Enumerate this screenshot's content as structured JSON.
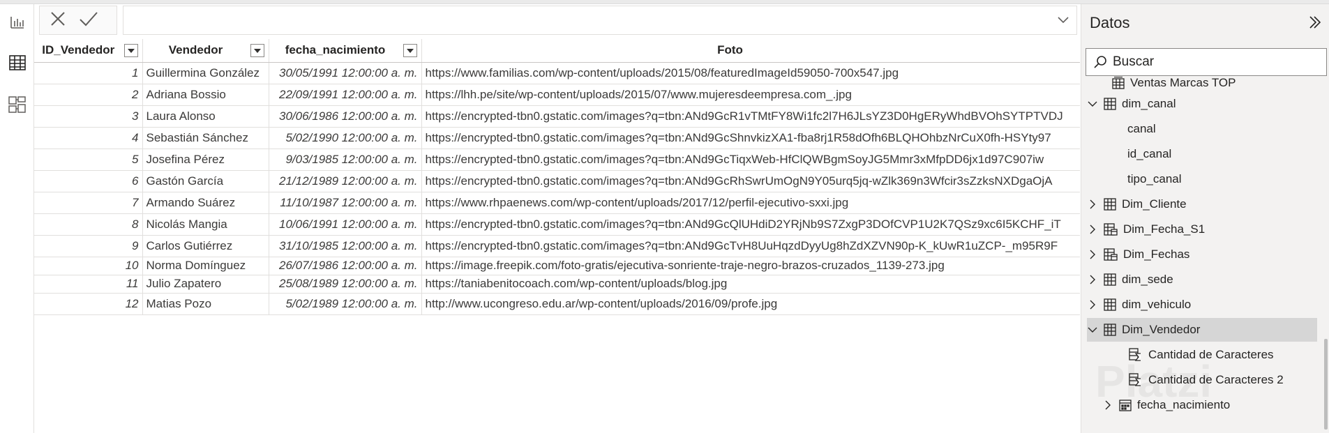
{
  "formula_bar": {
    "cancel_icon": "close-icon",
    "commit_icon": "checkmark-icon",
    "value": ""
  },
  "table": {
    "columns": [
      "ID_Vendedor",
      "Vendedor",
      "fecha_nacimiento",
      "Foto"
    ],
    "rows": [
      {
        "id": "1",
        "vendedor": "Guillermina González",
        "fecha": "30/05/1991 12:00:00 a. m.",
        "foto": "https://www.familias.com/wp-content/uploads/2015/08/featuredImageId59050-700x547.jpg"
      },
      {
        "id": "2",
        "vendedor": "Adriana Bossio",
        "fecha": "22/09/1991 12:00:00 a. m.",
        "foto": "https://lhh.pe/site/wp-content/uploads/2015/07/www.mujeresdeempresa.com_.jpg"
      },
      {
        "id": "3",
        "vendedor": "Laura Alonso",
        "fecha": "30/06/1986 12:00:00 a. m.",
        "foto": "https://encrypted-tbn0.gstatic.com/images?q=tbn:ANd9GcR1vTMtFY8Wi1fc2l7H6JLsYZ3D0HgERyWhdBVOhSYTPTVDJ"
      },
      {
        "id": "4",
        "vendedor": "Sebastián Sánchez",
        "fecha": "5/02/1990 12:00:00 a. m.",
        "foto": "https://encrypted-tbn0.gstatic.com/images?q=tbn:ANd9GcShnvkizXA1-fba8rj1R58dOfh6BLQHOhbzNrCuX0fh-HSYty97"
      },
      {
        "id": "5",
        "vendedor": "Josefina Pérez",
        "fecha": "9/03/1985 12:00:00 a. m.",
        "foto": "https://encrypted-tbn0.gstatic.com/images?q=tbn:ANd9GcTiqxWeb-HfClQWBgmSoyJG5Mmr3xMfpDD6jx1d97C907iw"
      },
      {
        "id": "6",
        "vendedor": "Gastón García",
        "fecha": "21/12/1989 12:00:00 a. m.",
        "foto": "https://encrypted-tbn0.gstatic.com/images?q=tbn:ANd9GcRhSwrUmOgN9Y05urq5jq-wZlk369n3Wfcir3sZzksNXDgaOjA"
      },
      {
        "id": "7",
        "vendedor": "Armando Suárez",
        "fecha": "11/10/1987 12:00:00 a. m.",
        "foto": "https://www.rhpaenews.com/wp-content/uploads/2017/12/perfil-ejecutivo-sxxi.jpg"
      },
      {
        "id": "8",
        "vendedor": "Nicolás Mangia",
        "fecha": "10/06/1991 12:00:00 a. m.",
        "foto": "https://encrypted-tbn0.gstatic.com/images?q=tbn:ANd9GcQlUHdiD2YRjNb9S7ZxgP3DOfCVP1U2K7QSz9xc6I5KCHF_iT"
      },
      {
        "id": "9",
        "vendedor": "Carlos Gutiérrez",
        "fecha": "31/10/1985 12:00:00 a. m.",
        "foto": "https://encrypted-tbn0.gstatic.com/images?q=tbn:ANd9GcTvH8UuHqzdDyyUg8hZdXZVN90p-K_kUwR1uZCP-_m95R9F"
      },
      {
        "id": "10",
        "vendedor": "Norma Domínguez",
        "fecha": "26/07/1986 12:00:00 a. m.",
        "foto": "https://image.freepik.com/foto-gratis/ejecutiva-sonriente-traje-negro-brazos-cruzados_1139-273.jpg"
      },
      {
        "id": "11",
        "vendedor": "Julio Zapatero",
        "fecha": "25/08/1989 12:00:00 a. m.",
        "foto": "https://taniabenitocoach.com/wp-content/uploads/blog.jpg"
      },
      {
        "id": "12",
        "vendedor": "Matias Pozo",
        "fecha": "5/02/1989 12:00:00 a. m.",
        "foto": "http://www.ucongreso.edu.ar/wp-content/uploads/2016/09/profe.jpg"
      }
    ]
  },
  "data_pane": {
    "title": "Datos",
    "search_placeholder": "Buscar",
    "items": [
      {
        "label": "Ventas Marcas TOP",
        "icon": "calculated-table-icon"
      },
      {
        "label": "dim_canal",
        "icon": "table-icon",
        "expanded": true
      },
      {
        "label": "canal"
      },
      {
        "label": "id_canal"
      },
      {
        "label": "tipo_canal"
      },
      {
        "label": "Dim_Cliente",
        "icon": "table-icon"
      },
      {
        "label": "Dim_Fecha_S1",
        "icon": "calendar-table-icon"
      },
      {
        "label": "Dim_Fechas",
        "icon": "calendar-table-icon"
      },
      {
        "label": "dim_sede",
        "icon": "table-icon"
      },
      {
        "label": "dim_vehiculo",
        "icon": "table-icon"
      },
      {
        "label": "Dim_Vendedor",
        "icon": "table-icon",
        "expanded": true,
        "selected": true
      },
      {
        "label": "Cantidad de Caracteres",
        "icon": "calculated-column-icon"
      },
      {
        "label": "Cantidad de Caracteres 2",
        "icon": "calculated-column-icon"
      },
      {
        "label": "fecha_nacimiento",
        "icon": "date-hierarchy-icon"
      }
    ]
  },
  "watermark": "Platzi",
  "colors": {
    "selected_row": "#d6d6d6",
    "pane_bg": "#f3f2f1",
    "grid_line": "#e1dfdd"
  }
}
